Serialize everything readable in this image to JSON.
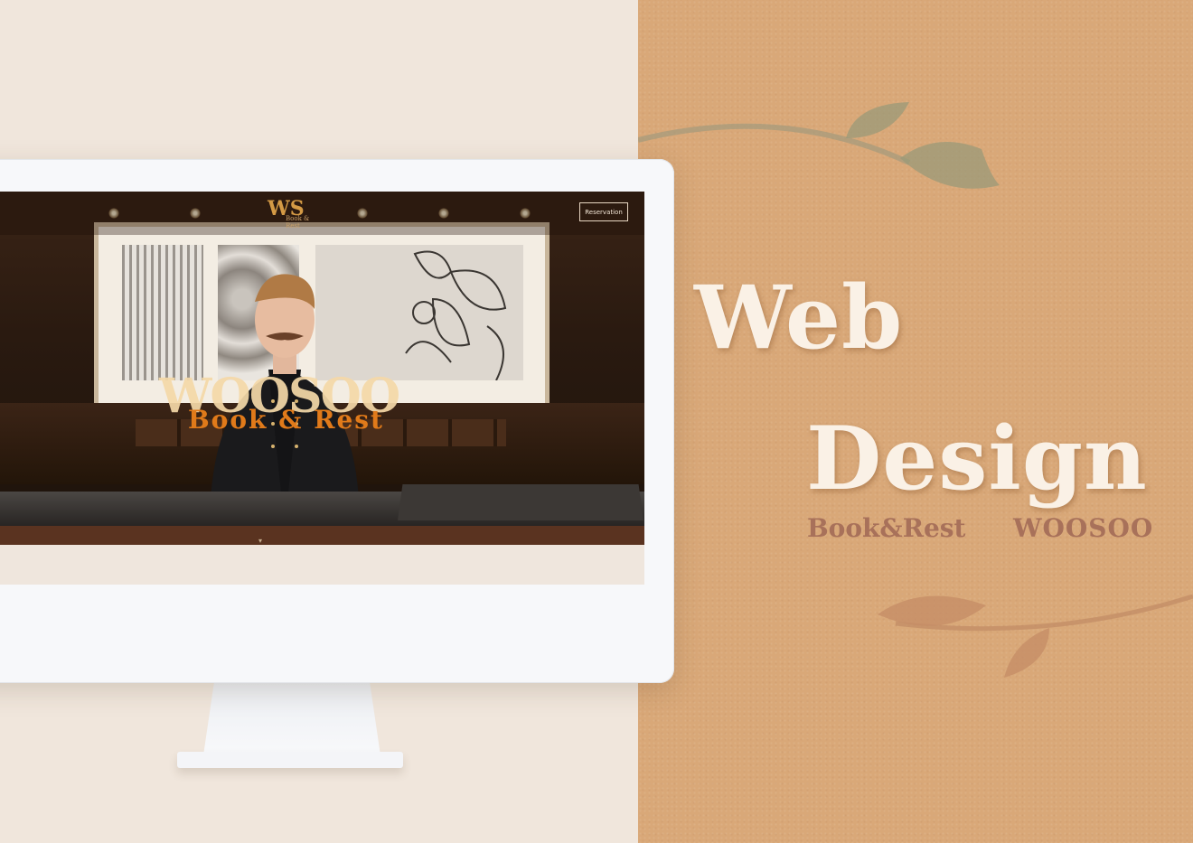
{
  "headline": {
    "line1": "Web",
    "line2": "Design"
  },
  "subtitle": {
    "left": "Book&Rest",
    "right": "WOOSOO"
  },
  "website": {
    "nav": {
      "logo_mark": "WS",
      "logo_tagline": "Book & Rest",
      "reservation_label": "Reservation"
    },
    "hero": {
      "logo_text": "WOOSOO",
      "tagline": "Book & Rest"
    }
  },
  "colors": {
    "panel": "#d9a878",
    "headline": "#faf1e6",
    "subtitle": "#a8715a",
    "accent_orange": "#e07a1a"
  }
}
